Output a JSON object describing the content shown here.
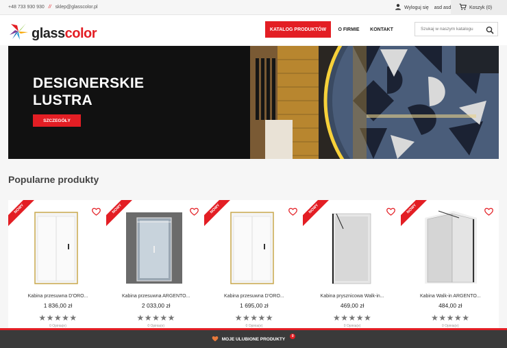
{
  "topbar": {
    "phone": "+48 733 930 930",
    "separator": "//",
    "email": "sklep@glasscolor.pl",
    "logout_label": "Wyloguj się",
    "user_name": "asd asd",
    "cart_label": "Koszyk (0)"
  },
  "header": {
    "logo_part1": "glass",
    "logo_part2": "color",
    "nav": [
      {
        "label": "KATALOG PRODUKTÓW"
      },
      {
        "label": "O FIRMIE"
      },
      {
        "label": "KONTAKT"
      }
    ],
    "search_placeholder": "Szukaj w naszym katalogu"
  },
  "banner": {
    "title_line1": "DESIGNERSKIE",
    "title_line2": "LUSTRA",
    "button_label": "SZCZEGÓŁY"
  },
  "section": {
    "title": "Popularne produkty"
  },
  "products": [
    {
      "badge": "NOWY",
      "name": "Kabina przesuwna D'ORO...",
      "price": "1 836,00 zł",
      "stars": "★★★★★",
      "reviews": "0 Opinia(e)",
      "image_icon": "shower-cabin-gold-icon"
    },
    {
      "badge": "NOWY",
      "name": "Kabina przesuwna ARGENTO...",
      "price": "2 033,00 zł",
      "stars": "★★★★★",
      "reviews": "0 Opinia(e)",
      "image_icon": "shower-cabin-dark-icon"
    },
    {
      "badge": "NOWY",
      "name": "Kabina przesuwna D'ORO...",
      "price": "1 695,00 zł",
      "stars": "★★★★★",
      "reviews": "0 Opinia(e)",
      "image_icon": "shower-cabin-gold-icon"
    },
    {
      "badge": "NOWY",
      "name": "Kabina prysznicowa Walk-in...",
      "price": "469,00 zł",
      "stars": "★★★★★",
      "reviews": "0 Opinia(e)",
      "image_icon": "walk-in-panel-icon"
    },
    {
      "badge": "NOWY",
      "name": "Kabina Walk-in ARGENTO...",
      "price": "484,00 zł",
      "stars": "★★★★★",
      "reviews": "0 Opinia(e)",
      "image_icon": "walk-in-corner-icon"
    }
  ],
  "bottom_bar": {
    "label": "MOJE ULUBIONE PRODUKTY",
    "count": "0"
  },
  "colors": {
    "accent": "#e31e24",
    "dark": "#232323",
    "bottom_bar": "#3a3a3a"
  }
}
